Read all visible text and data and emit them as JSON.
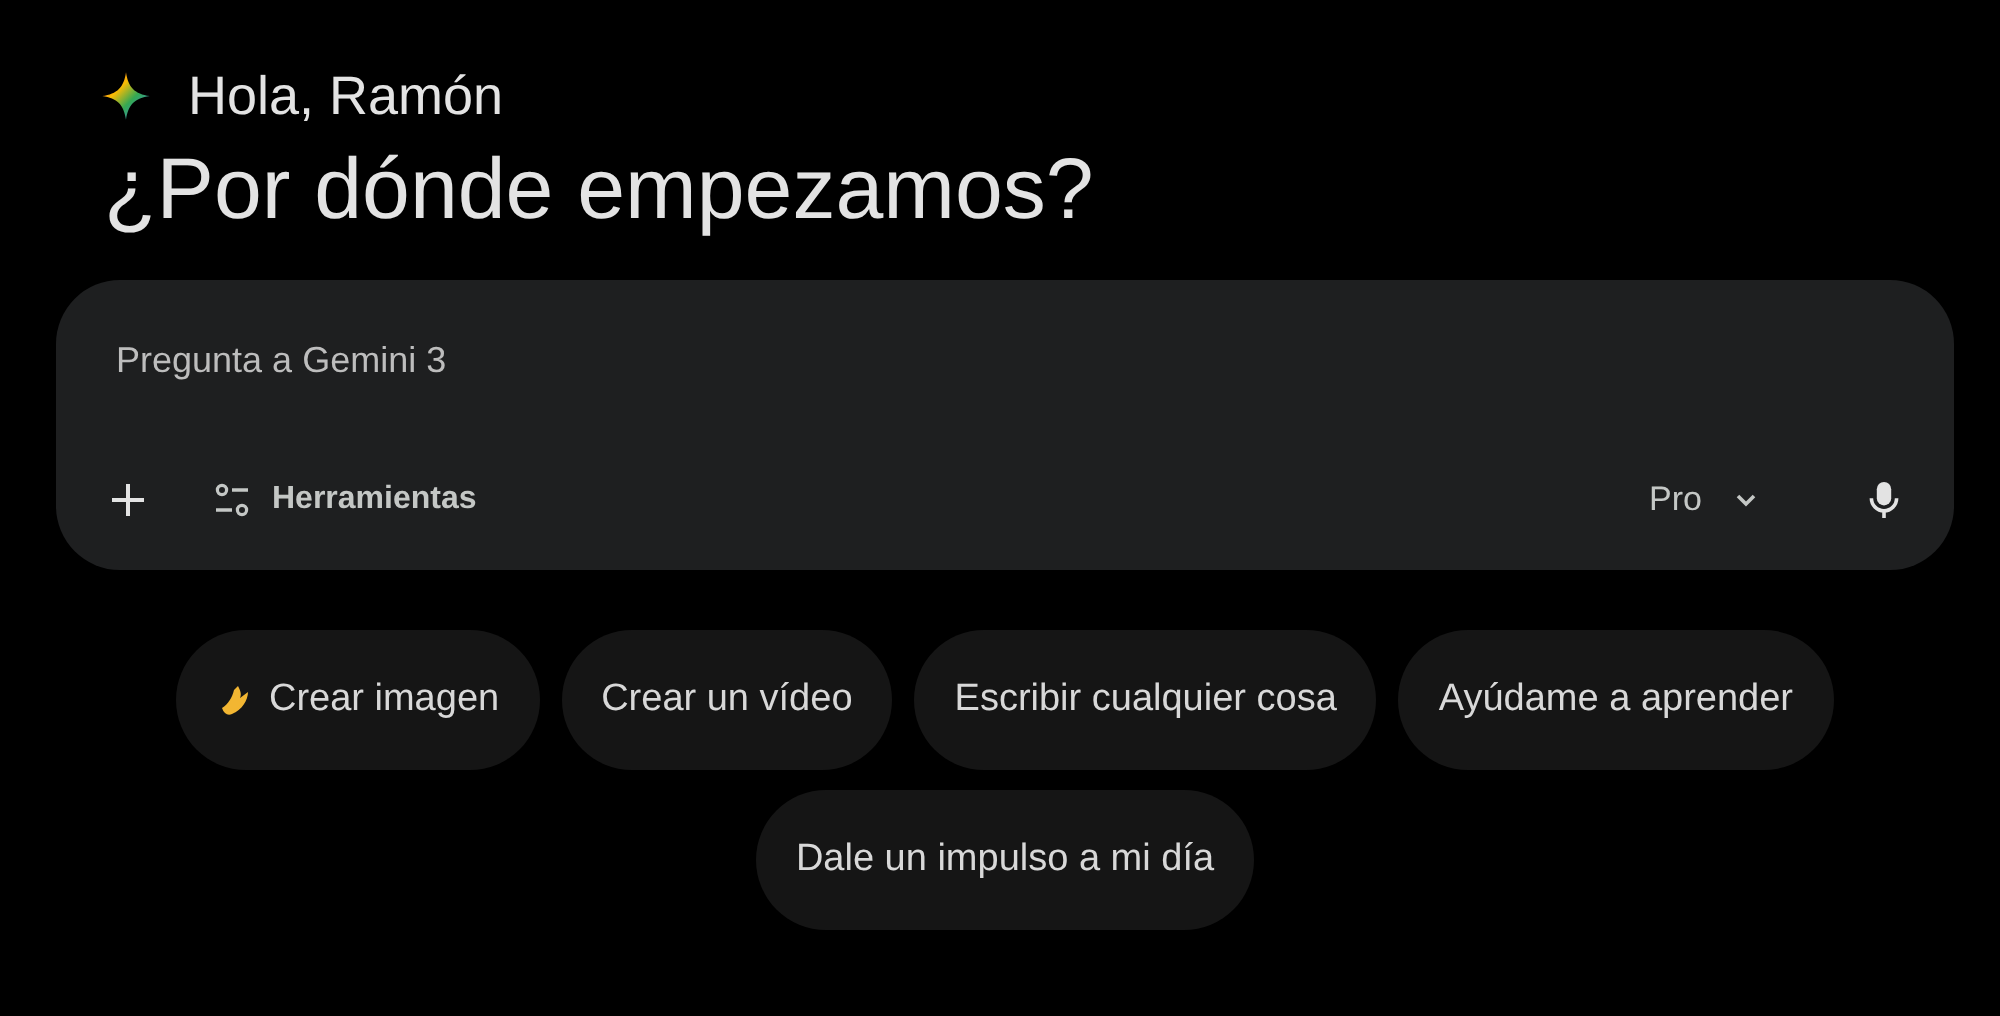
{
  "greeting": "Hola, Ramón",
  "heading": "¿Por dónde empezamos?",
  "prompt": {
    "placeholder": "Pregunta a Gemini 3",
    "tools_label": "Herramientas",
    "model": "Pro"
  },
  "chips": [
    {
      "label": "Crear imagen",
      "kind": "banana"
    },
    {
      "label": "Crear un vídeo",
      "kind": "plain"
    },
    {
      "label": "Escribir cualquier cosa",
      "kind": "plain"
    },
    {
      "label": "Ayúdame a aprender",
      "kind": "plain"
    },
    {
      "label": "Dale un impulso a mi día",
      "kind": "plain"
    }
  ]
}
